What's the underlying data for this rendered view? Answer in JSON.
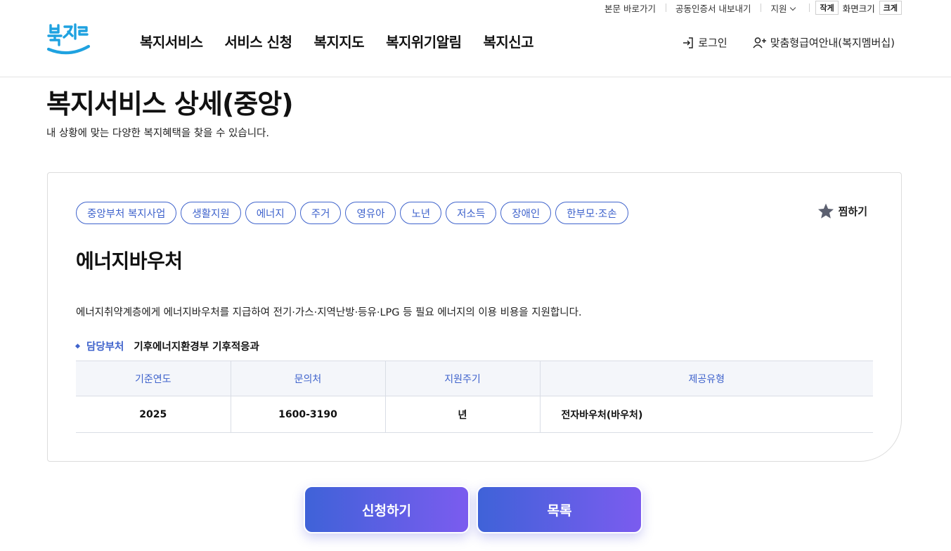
{
  "utility": {
    "skip_link": "본문 바로가기",
    "cert_export": "공동인증서 내보내기",
    "support": "지원",
    "zoom_small": "작게",
    "zoom_label": "화면크기",
    "zoom_large": "크게"
  },
  "header": {
    "logo_text": "복지로",
    "nav": [
      "복지서비스",
      "서비스 신청",
      "복지지도",
      "복지위기알림",
      "복지신고"
    ],
    "login": "로그인",
    "membership": "맞춤형급여안내(복지멤버십)"
  },
  "page": {
    "title": "복지서비스 상세(중앙)",
    "description": "내 상황에 맞는 다양한 복지혜택을 찾을 수 있습니다."
  },
  "service": {
    "tags": [
      "중앙부처 복지사업",
      "생활지원",
      "에너지",
      "주거",
      "영유아",
      "노년",
      "저소득",
      "장애인",
      "한부모·조손"
    ],
    "favorite_label": "찜하기",
    "title": "에너지바우처",
    "description": "에너지취약계층에게 에너지바우처를 지급하여 전기·가스·지역난방·등유·LPG 등 필요 에너지의 이용 비용을 지원합니다.",
    "dept_label": "담당부처",
    "dept_value": "기후에너지환경부 기후적응과",
    "table": {
      "headers": [
        "기준연도",
        "문의처",
        "지원주기",
        "제공유형"
      ],
      "row": [
        "2025",
        "1600-3190",
        "년",
        "전자바우처(바우처)"
      ]
    }
  },
  "actions": {
    "apply": "신청하기",
    "list": "목록"
  },
  "colors": {
    "accent": "#3f63cc",
    "button_gradient_start": "#3f62d8",
    "button_gradient_end": "#7b5cef",
    "logo_blue": "#1fa2e0"
  }
}
